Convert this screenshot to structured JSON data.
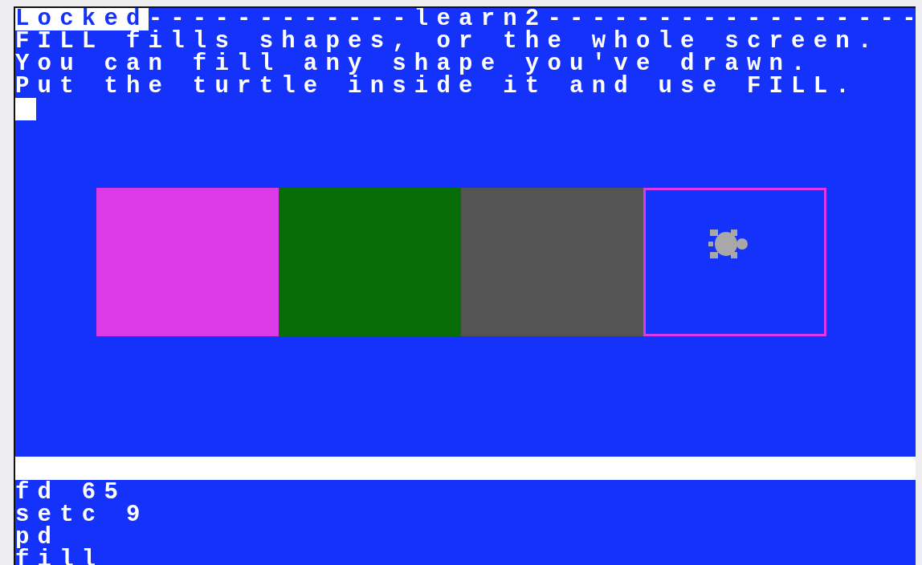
{
  "header": {
    "status": "Locked",
    "left_rule": "------------",
    "title": "learn2",
    "right_rule": "-----------------"
  },
  "message_lines": [
    "FILL fills shapes, or the whole screen.",
    "You can fill any shape you've drawn.",
    "Put the turtle inside it and use FILL."
  ],
  "shapes": [
    {
      "kind": "filled",
      "color": "#dc3ae6"
    },
    {
      "kind": "filled",
      "color": "#076e07"
    },
    {
      "kind": "filled",
      "color": "#545454"
    },
    {
      "kind": "outline",
      "color": "#dc3ae6"
    }
  ],
  "commands": [
    "fd 65",
    "setc 9",
    "pd",
    "fill"
  ]
}
